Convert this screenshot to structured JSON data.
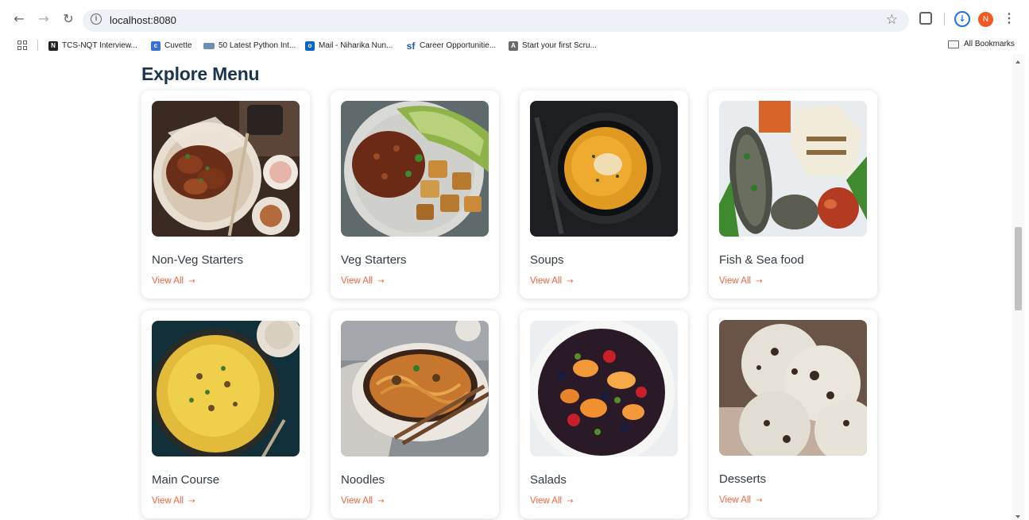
{
  "browser": {
    "url": "localhost:8080",
    "bookmarks": [
      {
        "label": "TCS-NQT Interview...",
        "icon_color": "#202124"
      },
      {
        "label": "Cuvette",
        "icon_color": "#3b6fd8"
      },
      {
        "label": "50 Latest Python Int...",
        "icon_color": "#6d8fb5"
      },
      {
        "label": "Mail - Niharika Nun...",
        "icon_color": "#0a66c2"
      },
      {
        "label": "Career Opportunitie...",
        "icon_color": "#1a5dab"
      },
      {
        "label": "Start your first Scru...",
        "icon_color": "#6b6b6b"
      }
    ],
    "all_bookmarks": "All Bookmarks",
    "avatar_initial": "N"
  },
  "menu": {
    "title": "Explore Menu",
    "view_all_label": "View All",
    "accent_color": "#f0643c",
    "items": [
      {
        "name": "Non-Veg Starters"
      },
      {
        "name": "Veg Starters"
      },
      {
        "name": "Soups"
      },
      {
        "name": "Fish & Sea food"
      },
      {
        "name": "Main Course"
      },
      {
        "name": "Noodles"
      },
      {
        "name": "Salads"
      },
      {
        "name": "Desserts"
      }
    ]
  }
}
